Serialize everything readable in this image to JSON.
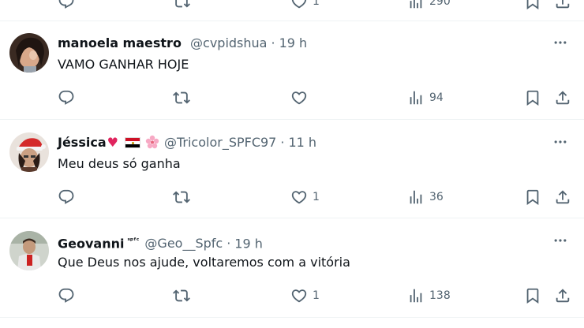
{
  "top_partial": {
    "likes": "1",
    "views": "290"
  },
  "replies": [
    {
      "name": "manoela maestro",
      "name_suffix": "",
      "handle": "@cvpidshua",
      "separator": "·",
      "time": "19 h",
      "text": "VAMO GANHAR HOJE",
      "likes": "",
      "views": "94"
    },
    {
      "name": "Jéssica",
      "name_suffix": "",
      "handle": "@Tricolor_SPFC97",
      "separator": "·",
      "time": "11 h",
      "text": "Meu deus só ganha",
      "likes": "1",
      "views": "36"
    },
    {
      "name": "Geovanni",
      "name_suffix": "ˢᵖᶠᶜ",
      "handle": "@Geo__Spfc",
      "separator": "·",
      "time": "19 h",
      "text": "Que Deus nos ajude, voltaremos com a vitória",
      "likes": "1",
      "views": "138"
    }
  ],
  "icons": {
    "reply": "speech-bubble-icon",
    "retweet": "retweet-arrows-icon",
    "like": "heart-outline-icon",
    "views": "bar-chart-icon",
    "bookmark": "bookmark-icon",
    "share": "share-upload-icon",
    "more": "three-dots-icon",
    "heart_emoji": "red-heart-emoji",
    "flag": "egypt-flag-emoji",
    "flower": "cherry-blossom-emoji"
  },
  "colors": {
    "text_primary": "#0f1419",
    "text_secondary": "#536471",
    "divider": "#eff3f4",
    "heart_emoji": "#e0245e"
  }
}
